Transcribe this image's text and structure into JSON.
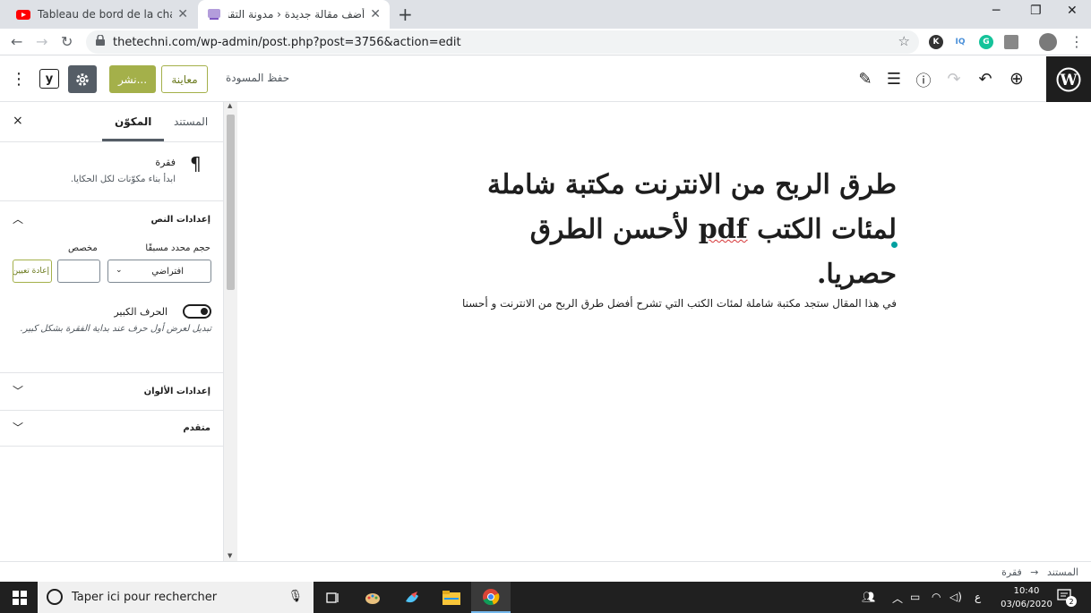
{
  "browser": {
    "tabs": [
      {
        "title": "Tableau de bord de la chaîne - Yo",
        "icon": "youtube-icon",
        "active": false
      },
      {
        "title": "أضف مقالة جديدة ‹ مدونة التقني —",
        "icon": "site-favicon",
        "active": true
      }
    ],
    "new_tab_label": "+",
    "url": "thetechni.com/wp-admin/post.php?post=3756&action=edit",
    "extensions": [
      "K",
      "IQ",
      "G"
    ]
  },
  "wp_toolbar": {
    "publish_label": "نشر...",
    "preview_label": "معاينة",
    "save_draft_label": "حفظ المسودة",
    "yoast_label": "y",
    "icons": [
      "inserter-plus-icon",
      "undo-icon",
      "redo-icon",
      "info-icon",
      "outline-list-icon",
      "edit-pencil-icon",
      "settings-gear-icon",
      "more-menu-icon",
      "wordpress-logo-icon"
    ]
  },
  "sidebar": {
    "tab_document": "المستند",
    "tab_block": "المكوّن",
    "close_label": "×",
    "block_card": {
      "title": "فقرة",
      "description": "ابدأ بناء مكوّنات لكل الحكايا."
    },
    "text_settings": {
      "title": "إعدادات النص",
      "preset_size_label": "حجم محدد مسبقًا",
      "custom_label": "مخصص",
      "select_value": "افتراضي",
      "reset_label": "إعادة تعيين"
    },
    "drop_cap": {
      "label": "الحرف الكبير",
      "help": "تبديل لعرض أول حرف عند بداية الفقرة بشكل كبير."
    },
    "color_settings_title": "إعدادات الألوان",
    "advanced_title": "متقدم"
  },
  "editor": {
    "title_part1": "طرق الربح من الانترنت مكتبة شاملة لمئات الكتب ",
    "title_pdf": "pdf",
    "title_part2": " لأحسن الطرق حصريا.",
    "paragraph": "في هذا المقال ستجد مكتبة شاملة لمئات الكتب التي تشرح أفضل طرق الربح من الانترنت و أحسنا"
  },
  "footer": {
    "crumb_document": "المستند",
    "crumb_arrow": "→",
    "crumb_block": "فقرة"
  },
  "taskbar": {
    "search_placeholder": "Taper ici pour rechercher",
    "time": "10:40",
    "date": "03/06/2020",
    "lang": "ع",
    "notification_count": "2"
  },
  "colors": {
    "publish": "#a4b04a",
    "wp_dark": "#1e1e1e",
    "taskbar": "#202020"
  }
}
